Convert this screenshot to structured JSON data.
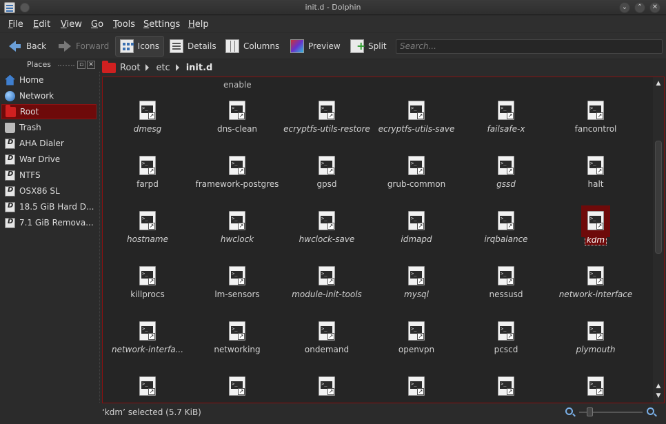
{
  "window": {
    "title": "init.d - Dolphin"
  },
  "menu": [
    "File",
    "Edit",
    "View",
    "Go",
    "Tools",
    "Settings",
    "Help"
  ],
  "toolbar": {
    "back": "Back",
    "forward": "Forward",
    "icons": "Icons",
    "details": "Details",
    "columns": "Columns",
    "preview": "Preview",
    "split": "Split",
    "search_placeholder": "Search..."
  },
  "places": {
    "title": "Places",
    "items": [
      {
        "label": "Home",
        "icon": "home-icon"
      },
      {
        "label": "Network",
        "icon": "network-icon"
      },
      {
        "label": "Root",
        "icon": "folder-icon",
        "selected": true
      },
      {
        "label": "Trash",
        "icon": "trash-icon"
      },
      {
        "label": "AHA Dialer",
        "icon": "drive-icon"
      },
      {
        "label": "War Drive",
        "icon": "drive-icon"
      },
      {
        "label": "NTFS",
        "icon": "drive-icon"
      },
      {
        "label": "OSX86 SL",
        "icon": "drive-icon"
      },
      {
        "label": "18.5 GiB Hard D...",
        "icon": "drive-icon"
      },
      {
        "label": "7.1 GiB Remova...",
        "icon": "drive-icon"
      }
    ]
  },
  "breadcrumb": [
    "Root",
    "etc",
    "init.d"
  ],
  "files": {
    "partial_top": "enable",
    "rows": [
      [
        {
          "name": "dmesg",
          "italic": true
        },
        {
          "name": "dns-clean",
          "italic": false
        },
        {
          "name": "ecryptfs-utils-restore",
          "italic": true
        },
        {
          "name": "ecryptfs-utils-save",
          "italic": true
        },
        {
          "name": "failsafe-x",
          "italic": true
        },
        {
          "name": "fancontrol",
          "italic": false
        }
      ],
      [
        {
          "name": "farpd",
          "italic": false
        },
        {
          "name": "framework-postgres",
          "italic": false
        },
        {
          "name": "gpsd",
          "italic": false
        },
        {
          "name": "grub-common",
          "italic": false
        },
        {
          "name": "gssd",
          "italic": true
        },
        {
          "name": "halt",
          "italic": false
        }
      ],
      [
        {
          "name": "hostname",
          "italic": true
        },
        {
          "name": "hwclock",
          "italic": true
        },
        {
          "name": "hwclock-save",
          "italic": true
        },
        {
          "name": "idmapd",
          "italic": true
        },
        {
          "name": "irqbalance",
          "italic": true
        },
        {
          "name": "kdm",
          "italic": true,
          "selected": true
        }
      ],
      [
        {
          "name": "killprocs",
          "italic": false
        },
        {
          "name": "lm-sensors",
          "italic": false
        },
        {
          "name": "module-init-tools",
          "italic": true
        },
        {
          "name": "mysql",
          "italic": true
        },
        {
          "name": "nessusd",
          "italic": false
        },
        {
          "name": "network-interface",
          "italic": true
        }
      ],
      [
        {
          "name": "network-interfa...",
          "italic": true
        },
        {
          "name": "networking",
          "italic": false
        },
        {
          "name": "ondemand",
          "italic": false
        },
        {
          "name": "openvpn",
          "italic": false
        },
        {
          "name": "pcscd",
          "italic": false
        },
        {
          "name": "plymouth",
          "italic": true
        }
      ]
    ]
  },
  "status": {
    "text": "‘kdm’ selected (5.7 KiB)"
  },
  "colors": {
    "selection": "#6e0a0a",
    "accent": "#d02020"
  }
}
